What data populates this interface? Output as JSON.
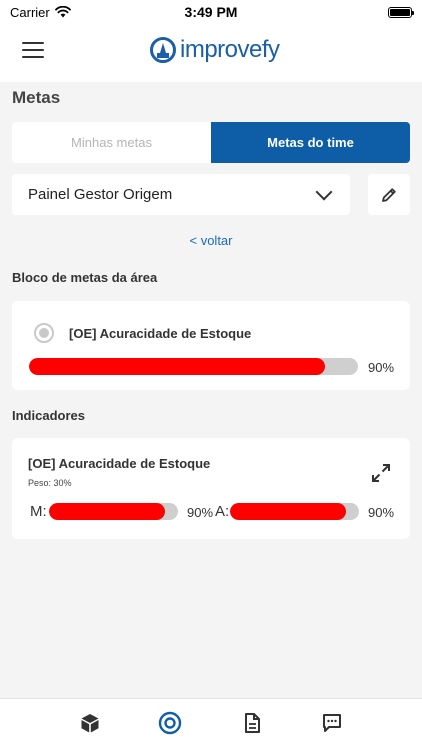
{
  "status_bar": {
    "carrier": "Carrier",
    "time": "3:49 PM"
  },
  "header": {
    "logo_text": "improvefy"
  },
  "page": {
    "title": "Metas"
  },
  "tabs": [
    {
      "label": "Minhas metas",
      "active": false
    },
    {
      "label": "Metas do time",
      "active": true
    }
  ],
  "panel_select": {
    "value": "Painel Gestor Origem"
  },
  "back_link": "< voltar",
  "block_section": {
    "title": "Bloco de metas da área",
    "card": {
      "title": "[OE] Acuracidade de Estoque",
      "progress": 0.9,
      "percent_label": "90%"
    }
  },
  "indicators_section": {
    "title": "Indicadores",
    "card": {
      "title": "[OE] Acuracidade de Estoque",
      "weight": "Peso: 30%",
      "m_label": "M:",
      "m_progress": 0.9,
      "m_percent": "90%",
      "a_label": "A:",
      "a_progress": 0.9,
      "a_percent": "90%"
    }
  },
  "bottom_nav": [
    "box-icon",
    "target-icon",
    "document-icon",
    "chat-icon"
  ],
  "colors": {
    "brand_blue": "#0d5ea6",
    "progress_red": "#ff0000",
    "track_gray": "#cfcfcf",
    "link_blue": "#1b6bb8"
  }
}
